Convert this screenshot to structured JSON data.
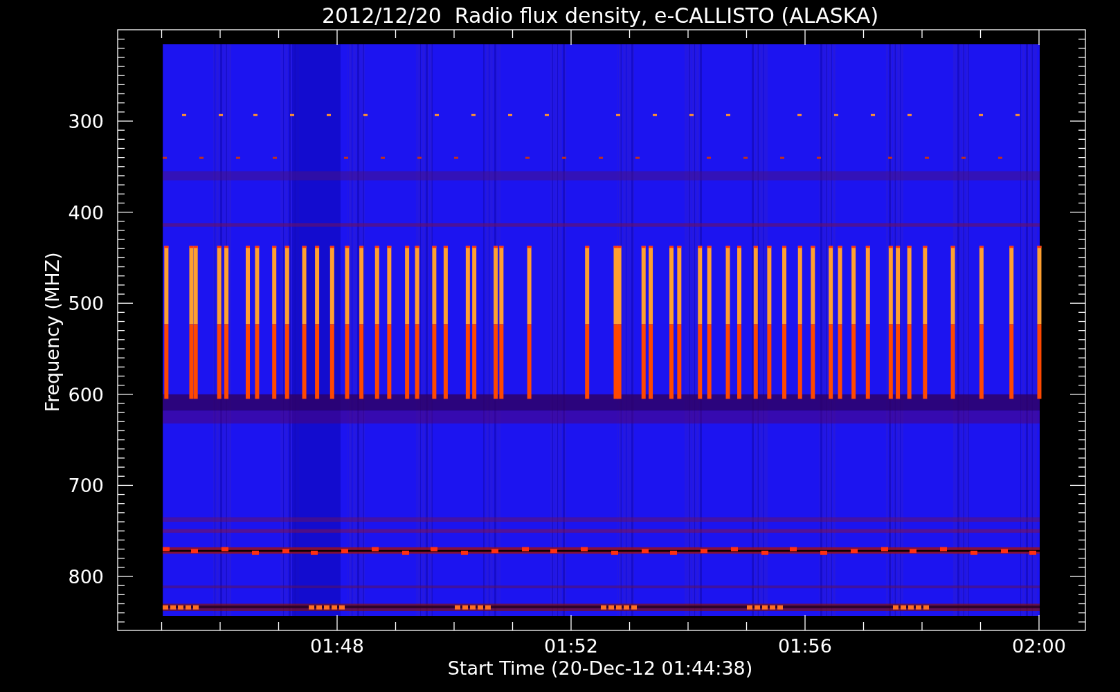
{
  "plot": {
    "title": "2012/12/20  Radio flux density, e-CALLISTO (ALASKA)",
    "ylabel": "Frequency (MHZ)",
    "yticks": [
      "300",
      "400",
      "500",
      "600",
      "700",
      "800"
    ],
    "xticks": [
      "01:48",
      "01:52",
      "01:56",
      "02:00"
    ],
    "xlabel": "Start Time (20-Dec-12 01:44:38)"
  }
}
